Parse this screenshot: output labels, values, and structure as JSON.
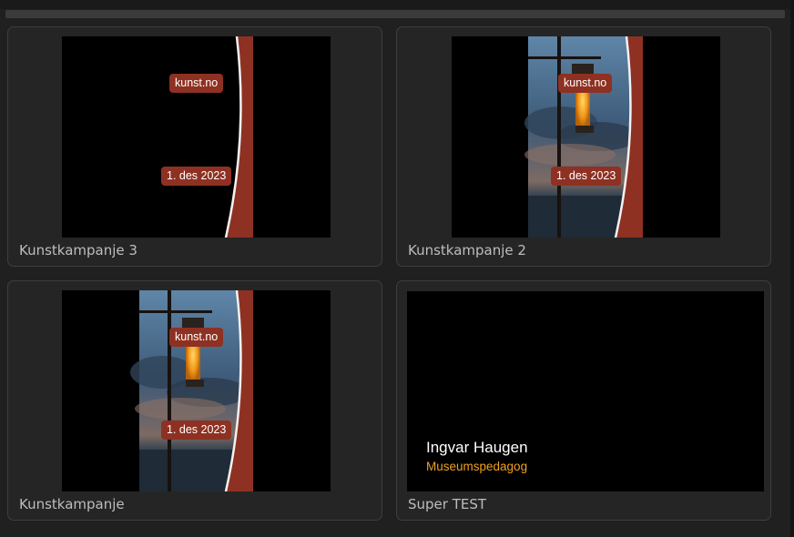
{
  "campaigns": [
    {
      "title": "Kunstkampanje 3",
      "badge_top": "kunst.no",
      "badge_bottom": "1. des 2023"
    },
    {
      "title": "Kunstkampanje 2",
      "badge_top": "kunst.no",
      "badge_bottom": "1. des 2023"
    },
    {
      "title": "Kunstkampanje",
      "badge_top": "kunst.no",
      "badge_bottom": "1. des 2023"
    },
    {
      "title": "Super TEST",
      "lower_third_name": "Ingvar Haugen",
      "lower_third_role": "Museumspedagog"
    }
  ],
  "colors": {
    "background": "#202020",
    "card": "#252525",
    "badge": "#8e3122",
    "accent_orange": "#f0a020"
  }
}
